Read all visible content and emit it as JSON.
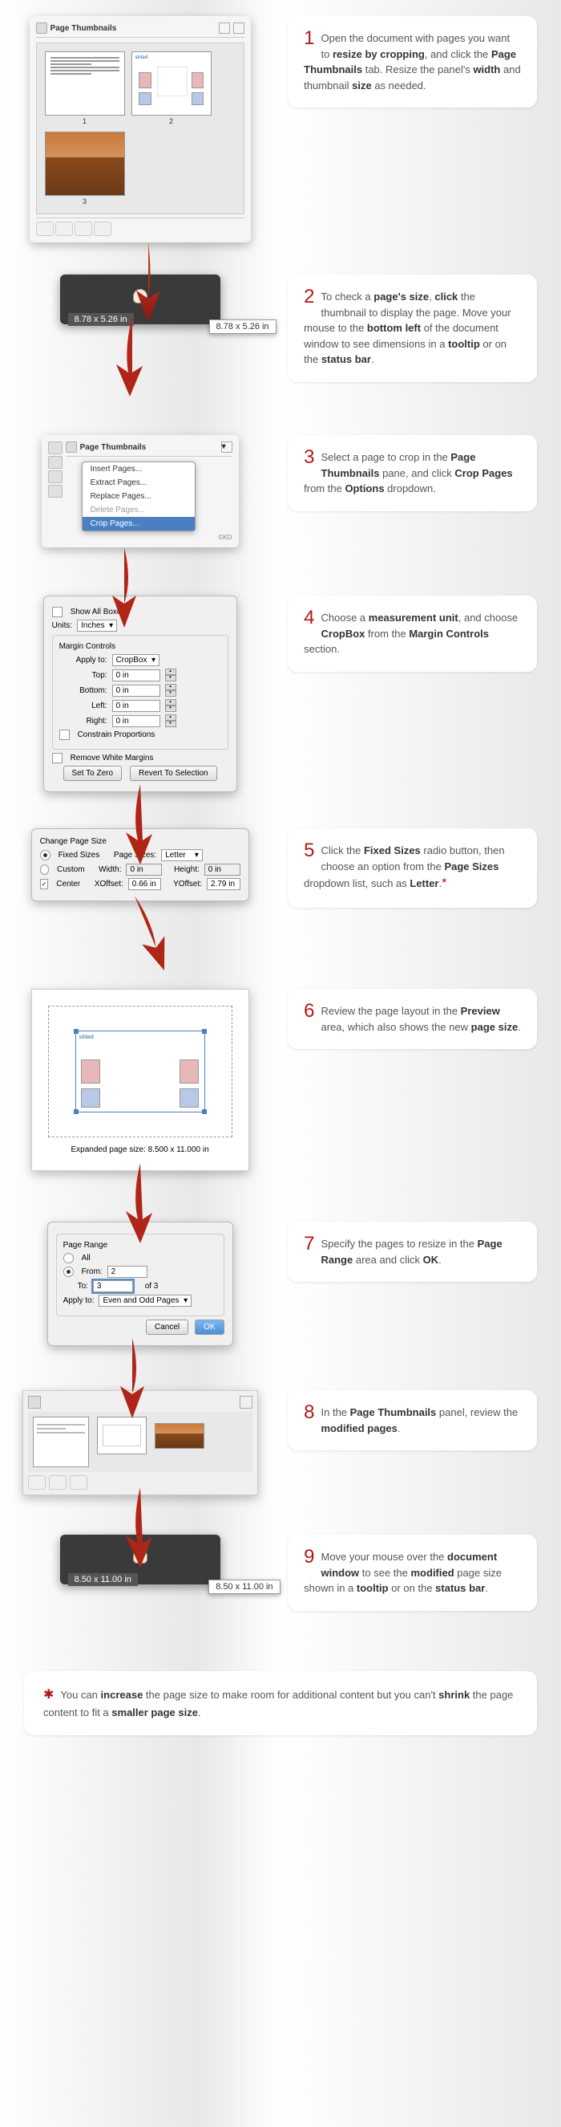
{
  "panel1": {
    "title": "Page Thumbnails"
  },
  "step1": {
    "text_parts": [
      "Open the document with pages you want to ",
      "resize by cropping",
      ", and click the ",
      "Page Thumbnails",
      " tab. Resize the panel's ",
      "width",
      " and thumbnail ",
      "size",
      " as needed."
    ]
  },
  "step2": {
    "dim1": "8.78 x 5.26 in",
    "dim2": "8.78 x 5.26 in",
    "text_parts": [
      "To check a ",
      "page's size",
      ", ",
      "click",
      " the thumbnail to display the page. Move your mouse to the ",
      "bottom left",
      " of the document window to see dimensions in a ",
      "tooltip",
      " or on the ",
      "status bar",
      "."
    ]
  },
  "step3": {
    "title": "Page Thumbnails",
    "menu": [
      "Insert Pages...",
      "Extract Pages...",
      "Replace Pages...",
      "Delete Pages...",
      "Crop Pages..."
    ],
    "kd": "©KD",
    "text_parts": [
      "Select a page to crop in the ",
      "Page Thumbnails",
      " pane, and click ",
      "Crop Pages",
      " from the ",
      "Options",
      " dropdown."
    ]
  },
  "step4": {
    "show_all": "Show All Boxes",
    "units_label": "Units:",
    "units_value": "Inches",
    "section": "Margin Controls",
    "apply_label": "Apply to:",
    "apply_value": "CropBox",
    "top": "Top:",
    "bottom": "Bottom:",
    "left": "Left:",
    "right": "Right:",
    "zero": "0 in",
    "constrain": "Constrain Proportions",
    "remove_white": "Remove White Margins",
    "btn1": "Set To Zero",
    "btn2": "Revert To Selection",
    "text_parts": [
      "Choose a ",
      "measurement unit",
      ", and choose ",
      "CropBox",
      " from the ",
      "Margin Controls",
      " section."
    ]
  },
  "step5": {
    "section": "Change Page Size",
    "fixed": "Fixed Sizes",
    "sizes_label": "Page Sizes:",
    "sizes_value": "Letter",
    "custom": "Custom",
    "width_label": "Width:",
    "height_label": "Height:",
    "zero": "0 in",
    "center": "Center",
    "xoff_label": "XOffset:",
    "xoff_value": "0.66 in",
    "yoff_label": "YOffset:",
    "yoff_value": "2.79 in",
    "text_parts": [
      "Click the ",
      "Fixed Sizes",
      " radio button, then choose an option from the ",
      "Page Sizes",
      " dropdown list, such as ",
      "Letter",
      "."
    ],
    "asterisk_note": "*"
  },
  "step6": {
    "label": "Expanded page size: 8.500 x 11.000 in",
    "logo": "shlad",
    "text_parts": [
      " Review the page layout in the ",
      "Preview",
      " area, which also shows the new ",
      "page size",
      "."
    ]
  },
  "step7": {
    "section": "Page Range",
    "all": "All",
    "from_label": "From:",
    "from_value": "2",
    "to_label": "To:",
    "to_value": "3",
    "of": "of 3",
    "apply_label": "Apply to:",
    "apply_value": "Even and Odd Pages",
    "cancel": "Cancel",
    "ok": "OK",
    "text_parts": [
      "Specify the pages to resize in the ",
      "Page Range",
      " area and click ",
      "OK",
      "."
    ]
  },
  "step8": {
    "text_parts": [
      "In the ",
      "Page Thumbnails",
      " panel, review the ",
      "modified pages",
      "."
    ]
  },
  "step9": {
    "dim1": "8.50 x 11.00 in",
    "dim2": "8.50 x 11.00 in",
    "text_parts": [
      "Move your mouse over the ",
      "document window",
      " to see the ",
      "modified",
      " page size shown in a ",
      "tooltip",
      " or on the ",
      "status bar",
      "."
    ]
  },
  "footnote": {
    "text_parts": [
      "You can ",
      "increase",
      " the page size to make room for additional content but you can't ",
      "shrink",
      " the page content to fit a ",
      "smaller page size",
      "."
    ]
  }
}
